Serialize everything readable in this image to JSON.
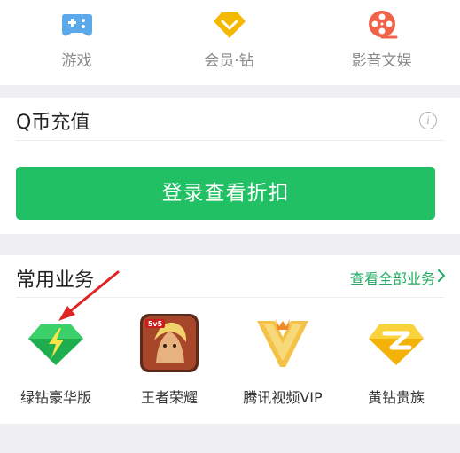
{
  "categories": [
    {
      "label": "游戏",
      "icon": "gamepad-icon",
      "color": "#56a6e8"
    },
    {
      "label": "会员·钻",
      "icon": "diamond-icon",
      "color": "#f4b400"
    },
    {
      "label": "影音文娱",
      "icon": "film-reel-icon",
      "color": "#f0624a"
    }
  ],
  "qcoin": {
    "title": "Q币充值",
    "info_icon": "info-icon",
    "login_button": "登录查看折扣",
    "accent": "#21c065"
  },
  "business": {
    "title": "常用业务",
    "view_all": "查看全部业务",
    "items": [
      {
        "label": "绿钻豪华版",
        "icon": "green-diamond-icon"
      },
      {
        "label": "王者荣耀",
        "icon": "honor-of-kings-icon"
      },
      {
        "label": "腾讯视频VIP",
        "icon": "tencent-video-vip-icon"
      },
      {
        "label": "黄钻贵族",
        "icon": "yellow-diamond-icon"
      }
    ],
    "link_color": "#21a960"
  }
}
